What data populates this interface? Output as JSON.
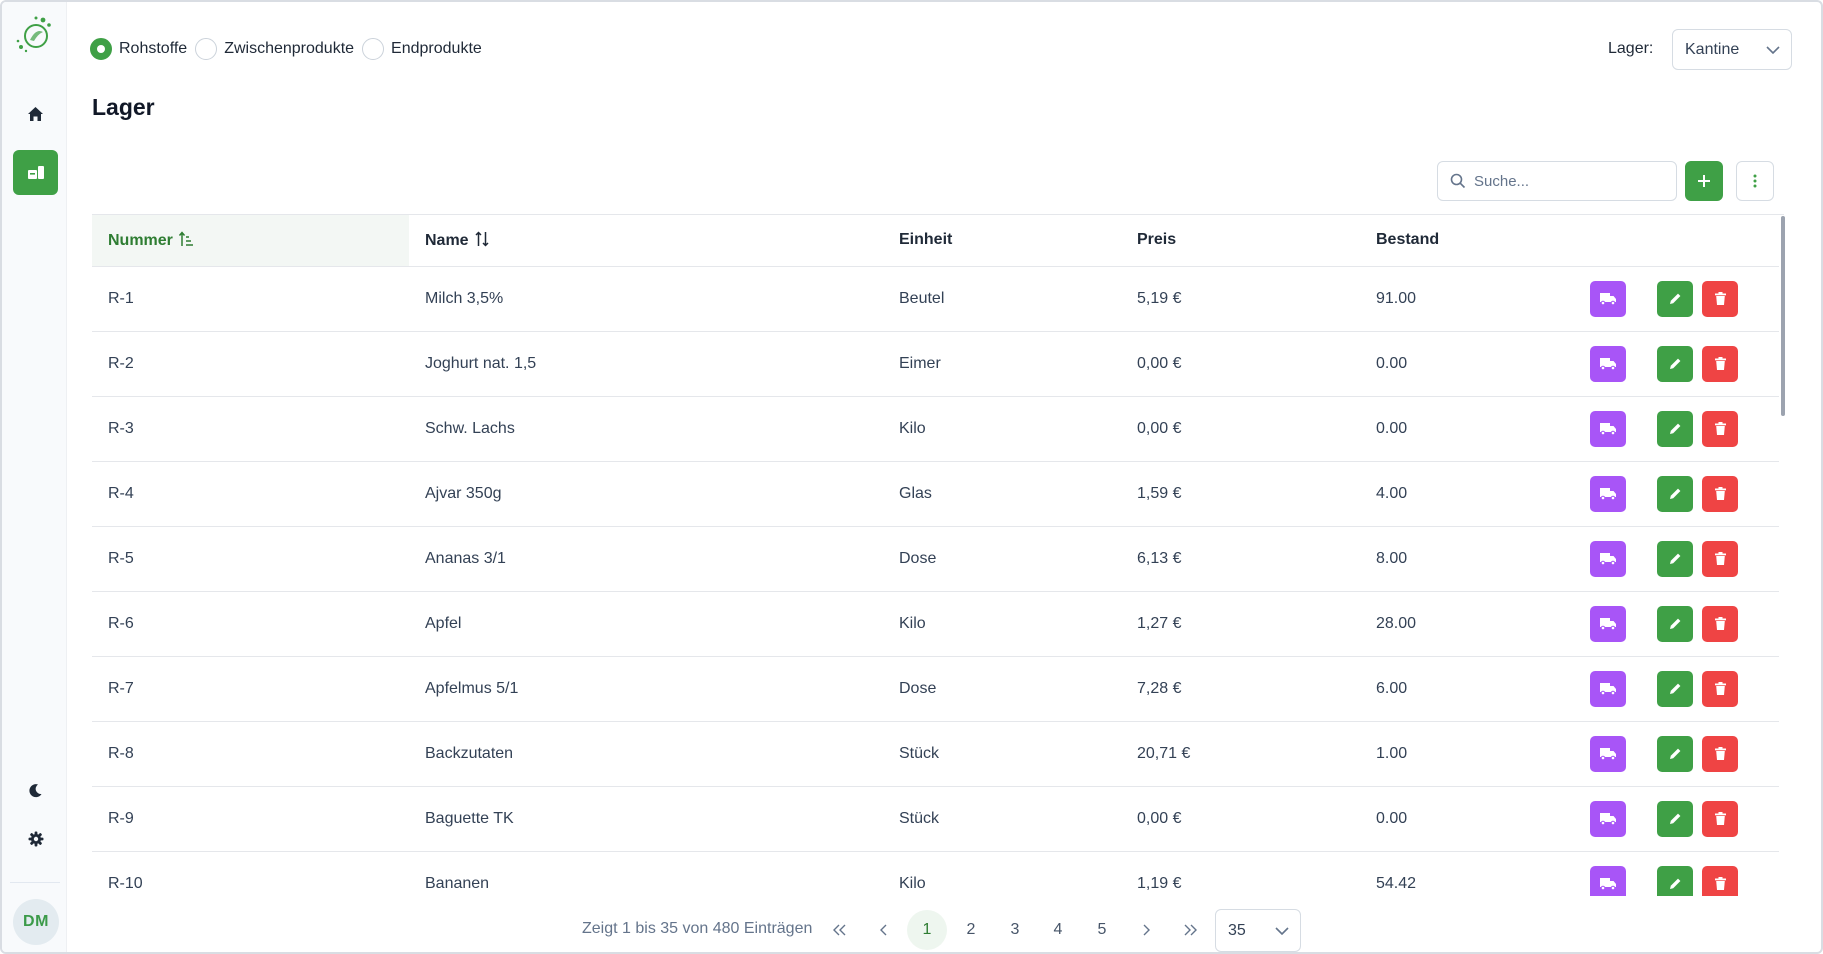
{
  "filter": {
    "options": [
      {
        "label": "Rohstoffe",
        "checked": true
      },
      {
        "label": "Zwischenprodukte",
        "checked": false
      },
      {
        "label": "Endprodukte",
        "checked": false
      }
    ]
  },
  "warehouse": {
    "label": "Lager:",
    "value": "Kantine"
  },
  "page_title": "Lager",
  "search": {
    "placeholder": "Suche..."
  },
  "table": {
    "columns": [
      "Nummer",
      "Name",
      "Einheit",
      "Preis",
      "Bestand"
    ],
    "rows": [
      [
        "R-1",
        "Milch 3,5%",
        "Beutel",
        "5,19 €",
        "91.00"
      ],
      [
        "R-2",
        "Joghurt nat. 1,5",
        "Eimer",
        "0,00 €",
        "0.00"
      ],
      [
        "R-3",
        "Schw. Lachs",
        "Kilo",
        "0,00 €",
        "0.00"
      ],
      [
        "R-4",
        "Ajvar 350g",
        "Glas",
        "1,59 €",
        "4.00"
      ],
      [
        "R-5",
        "Ananas 3/1",
        "Dose",
        "6,13 €",
        "8.00"
      ],
      [
        "R-6",
        "Apfel",
        "Kilo",
        "1,27 €",
        "28.00"
      ],
      [
        "R-7",
        "Apfelmus 5/1",
        "Dose",
        "7,28 €",
        "6.00"
      ],
      [
        "R-8",
        "Backzutaten",
        "Stück",
        "20,71 €",
        "1.00"
      ],
      [
        "R-9",
        "Baguette TK",
        "Stück",
        "0,00 €",
        "0.00"
      ],
      [
        "R-10",
        "Bananen",
        "Kilo",
        "1,19 €",
        "54.42"
      ]
    ]
  },
  "pagination": {
    "info": "Zeigt 1 bis 35 von 480 Einträgen",
    "pages": [
      "1",
      "2",
      "3",
      "4",
      "5"
    ],
    "first": "«",
    "prev": "‹",
    "next": "›",
    "last": "»",
    "page_size": "35"
  },
  "user": {
    "initials": "DM"
  },
  "colors": {
    "primary": "#3fa046",
    "truck": "#a855f7",
    "delete": "#ef4444"
  }
}
